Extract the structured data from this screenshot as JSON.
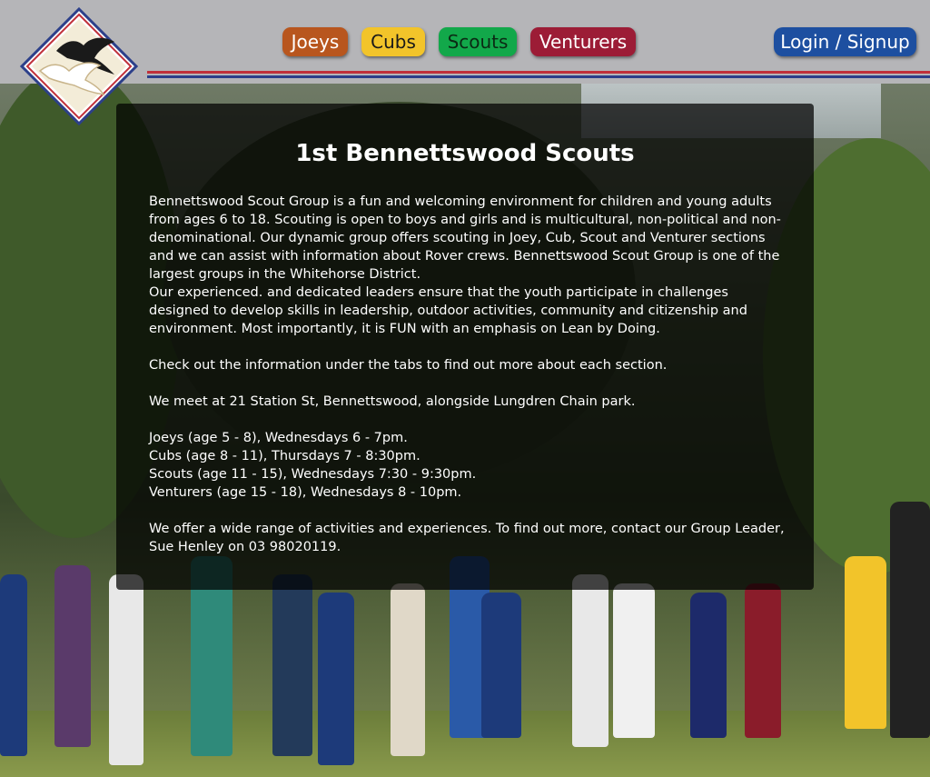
{
  "nav": {
    "joeys": "Joeys",
    "cubs": "Cubs",
    "scouts": "Scouts",
    "venturers": "Venturers",
    "login": "Login / Signup"
  },
  "main": {
    "title": "1st Bennettswood Scouts",
    "para1": "Bennettswood Scout Group is a fun and welcoming environment for children and young adults from ages 6 to 18. Scouting is open to boys and girls and is multicultural, non-political and non-denominational. Our dynamic group offers scouting in Joey, Cub, Scout and Venturer sections and we can assist with information about Rover crews. Bennettswood Scout Group is one of the largest groups in the Whitehorse District.",
    "para2": "Our experienced. and dedicated leaders ensure that the youth participate in challenges designed to develop skills in leadership, outdoor activities, community and citizenship and environment. Most importantly, it is FUN with an emphasis on Lean by Doing.",
    "para3": "Check out the information under the tabs to find out more about each section.",
    "para4": "We meet at 21 Station St, Bennettswood, alongside Lungdren Chain park.",
    "schedule": [
      "Joeys (age 5 - 8), Wednesdays 6 - 7pm.",
      "Cubs (age 8 - 11), Thursdays 7 - 8:30pm.",
      "Scouts (age 11 - 15), Wednesdays 7:30 - 9:30pm.",
      "Venturers (age 15 - 18), Wednesdays 8 - 10pm."
    ],
    "para5": "We offer a wide range of activities and experiences. To find out more, contact our Group Leader, Sue Henley on 03 98020119."
  },
  "icons": {
    "logo": "scouts-bird-diamond-logo"
  },
  "colors": {
    "header": "#b5b5b8",
    "joeys": "#b8561e",
    "cubs": "#f2c42a",
    "scouts": "#12a84a",
    "venturers": "#9c1c36",
    "login": "#1d4fa0"
  }
}
